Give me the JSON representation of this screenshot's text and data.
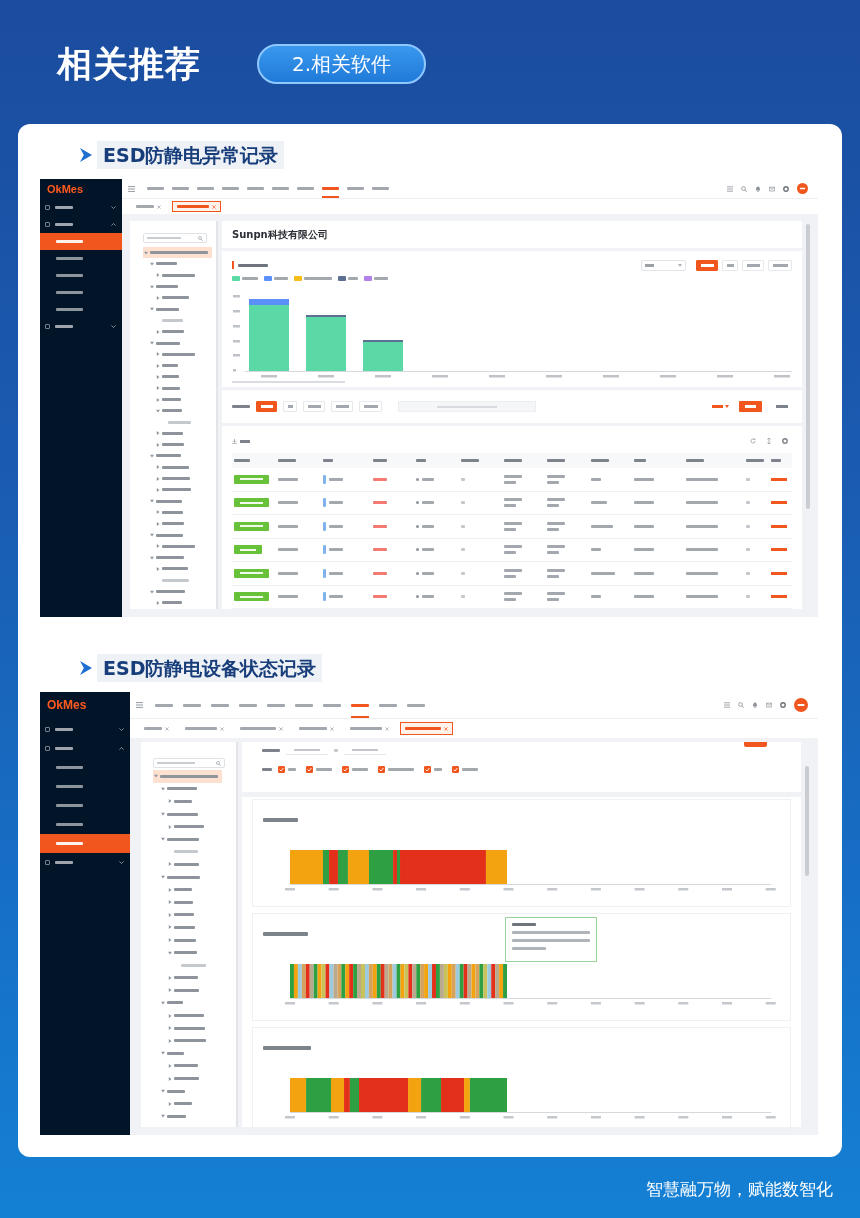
{
  "header": {
    "title": "相关推荐",
    "badge": "2.相关软件"
  },
  "sections": [
    {
      "title": "ESD防静电异常记录",
      "screen": {
        "kind": "alarm_records",
        "logo": "OkMes",
        "sidebar": [
          {
            "expanded": false
          },
          {
            "expanded": true,
            "children": [
              {
                "selected": true
              },
              {
                "selected": false
              },
              {
                "selected": false
              },
              {
                "selected": false
              },
              {
                "selected": false
              }
            ]
          },
          {
            "expanded": false
          }
        ],
        "nav": [
          {
            "selected": false
          },
          {
            "selected": false
          },
          {
            "selected": false
          },
          {
            "selected": false
          },
          {
            "selected": false
          },
          {
            "selected": false
          },
          {
            "selected": false
          },
          {
            "selected": true
          },
          {
            "selected": false
          },
          {
            "selected": false
          }
        ],
        "tabs": [
          {
            "selected": false
          },
          {
            "selected": true
          }
        ],
        "tree": [
          {
            "selected": true,
            "expanded": true,
            "children": [
              {
                "selected": false,
                "expanded": true,
                "children": [
                  {
                    "selected": false,
                    "expanded": false
                  }
                ]
              },
              {
                "selected": false,
                "expanded": true,
                "children": [
                  {
                    "selected": false,
                    "expanded": false
                  }
                ]
              },
              {
                "selected": false,
                "expanded": true,
                "children": [
                  {
                    "selected": false
                  },
                  {
                    "selected": false,
                    "expanded": false
                  }
                ]
              },
              {
                "selected": false,
                "expanded": true,
                "children": [
                  {
                    "selected": false,
                    "expanded": false
                  },
                  {
                    "selected": false,
                    "expanded": false
                  },
                  {
                    "selected": false,
                    "expanded": false
                  },
                  {
                    "selected": false,
                    "expanded": false
                  },
                  {
                    "selected": false,
                    "expanded": false
                  },
                  {
                    "selected": false,
                    "expanded": true,
                    "children": [
                      {
                        "selected": false
                      }
                    ]
                  },
                  {
                    "selected": false,
                    "expanded": false
                  },
                  {
                    "selected": false,
                    "expanded": false
                  }
                ]
              },
              {
                "selected": false,
                "expanded": true,
                "children": [
                  {
                    "selected": false,
                    "expanded": false
                  },
                  {
                    "selected": false,
                    "expanded": false
                  },
                  {
                    "selected": false,
                    "expanded": false
                  }
                ]
              },
              {
                "selected": false,
                "expanded": true,
                "children": [
                  {
                    "selected": false,
                    "expanded": false
                  },
                  {
                    "selected": false,
                    "expanded": false
                  }
                ]
              },
              {
                "selected": false,
                "expanded": true,
                "children": [
                  {
                    "selected": false,
                    "expanded": false
                  }
                ]
              },
              {
                "selected": false,
                "expanded": true,
                "children": [
                  {
                    "selected": false,
                    "expanded": false
                  },
                  {
                    "selected": false
                  }
                ]
              },
              {
                "selected": false,
                "expanded": true,
                "children": [
                  {
                    "selected": false,
                    "expanded": false
                  }
                ]
              }
            ]
          }
        ],
        "company": "Sunpn科技有限公司",
        "range_buttons": [
          {
            "selected": true
          },
          {
            "selected": false
          },
          {
            "selected": false
          },
          {
            "selected": false
          }
        ],
        "legend": [
          {
            "color": "#5ad8a6"
          },
          {
            "color": "#5b8ff9"
          },
          {
            "color": "#f6bd16"
          },
          {
            "color": "#5d7092"
          },
          {
            "color": "#b37feb"
          }
        ],
        "quick_filters": [
          {
            "selected": true
          },
          {
            "selected": false
          },
          {
            "selected": false
          },
          {
            "selected": false
          },
          {
            "selected": false
          }
        ]
      }
    },
    {
      "title": "ESD防静电设备状态记录",
      "screen": {
        "kind": "status_timeline",
        "logo": "OkMes",
        "sidebar": [
          {
            "expanded": false
          },
          {
            "expanded": true,
            "children": [
              {
                "selected": false
              },
              {
                "selected": false
              },
              {
                "selected": false
              },
              {
                "selected": false
              },
              {
                "selected": true
              }
            ]
          },
          {
            "expanded": false
          }
        ],
        "nav": [
          {
            "selected": false
          },
          {
            "selected": false
          },
          {
            "selected": false
          },
          {
            "selected": false
          },
          {
            "selected": false
          },
          {
            "selected": false
          },
          {
            "selected": false
          },
          {
            "selected": true
          },
          {
            "selected": false
          },
          {
            "selected": false
          }
        ],
        "tabs": [
          {
            "selected": false
          },
          {
            "selected": false
          },
          {
            "selected": false
          },
          {
            "selected": false
          },
          {
            "selected": false
          },
          {
            "selected": true
          }
        ],
        "tree": [
          {
            "selected": true,
            "expanded": true,
            "children": [
              {
                "selected": false,
                "expanded": true,
                "children": [
                  {
                    "selected": false,
                    "expanded": false
                  }
                ]
              },
              {
                "selected": false,
                "expanded": true,
                "children": [
                  {
                    "selected": false,
                    "expanded": false
                  }
                ]
              },
              {
                "selected": false,
                "expanded": true,
                "children": [
                  {
                    "selected": false
                  },
                  {
                    "selected": false,
                    "expanded": false
                  }
                ]
              },
              {
                "selected": false,
                "expanded": true,
                "children": [
                  {
                    "selected": false,
                    "expanded": false
                  },
                  {
                    "selected": false,
                    "expanded": false
                  },
                  {
                    "selected": false,
                    "expanded": false
                  },
                  {
                    "selected": false,
                    "expanded": false
                  },
                  {
                    "selected": false,
                    "expanded": false
                  },
                  {
                    "selected": false,
                    "expanded": true,
                    "children": [
                      {
                        "selected": false
                      }
                    ]
                  },
                  {
                    "selected": false,
                    "expanded": false
                  },
                  {
                    "selected": false,
                    "expanded": false
                  }
                ]
              },
              {
                "selected": false,
                "expanded": true,
                "children": [
                  {
                    "selected": false,
                    "expanded": false
                  },
                  {
                    "selected": false,
                    "expanded": false
                  },
                  {
                    "selected": false,
                    "expanded": false
                  }
                ]
              },
              {
                "selected": false,
                "expanded": true,
                "children": [
                  {
                    "selected": false,
                    "expanded": false
                  },
                  {
                    "selected": false,
                    "expanded": false
                  }
                ]
              },
              {
                "selected": false,
                "expanded": true,
                "children": [
                  {
                    "selected": false,
                    "expanded": false
                  }
                ]
              },
              {
                "selected": false,
                "expanded": true
              }
            ]
          }
        ],
        "type_filters": [
          {
            "checked": true
          },
          {
            "checked": true
          },
          {
            "checked": true
          },
          {
            "checked": true
          },
          {
            "checked": true
          },
          {
            "checked": true
          }
        ]
      }
    }
  ],
  "footer": {
    "slogan": "智慧融万物，赋能数智化"
  }
}
